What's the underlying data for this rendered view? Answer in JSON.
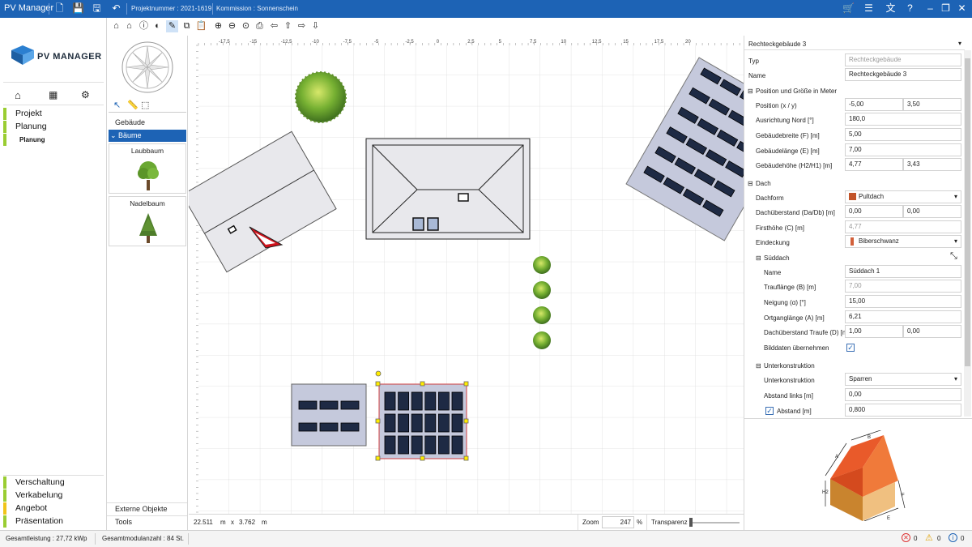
{
  "titlebar": {
    "app_name": "PV Manager",
    "project_number": "Projektnummer : 2021-1619",
    "commission": "Kommission : Sonnenschein"
  },
  "logo": {
    "text": "PV MANAGER"
  },
  "nav": {
    "sections_top": [
      {
        "label": "Projekt",
        "color": "#9acd32"
      },
      {
        "label": "Planung",
        "color": "#9acd32"
      }
    ],
    "sub_item": "Planung",
    "sections_bottom": [
      {
        "label": "Verschaltung",
        "color": "#9acd32"
      },
      {
        "label": "Verkabelung",
        "color": "#9acd32"
      },
      {
        "label": "Angebot",
        "color": "#f0c419"
      },
      {
        "label": "Präsentation",
        "color": "#9acd32"
      }
    ]
  },
  "catalog": {
    "group_buildings": "Gebäude",
    "group_trees": "Bäume",
    "card1": "Laubbaum",
    "card2": "Nadelbaum",
    "external": "Externe Objekte",
    "tools": "Tools"
  },
  "ruler": {
    "x_ticks": [
      "-17,5",
      "-15",
      "-12,5",
      "-10",
      "-7,5",
      "-5",
      "-2,5",
      "0",
      "2,5",
      "5",
      "7,5",
      "10",
      "12,5",
      "15",
      "17,5",
      "20"
    ]
  },
  "canvas_status": {
    "coord_x": "22.511",
    "unit1": "m",
    "times": "x",
    "coord_y": "3.762",
    "unit2": "m",
    "zoom_label": "Zoom",
    "zoom_value": "247",
    "zoom_unit": "%",
    "transparency_label": "Transparenz",
    "transparency": 0.0
  },
  "props": {
    "header": "Rechteckgebäude 3",
    "typ_label": "Typ",
    "typ_value": "Rechteckgebäude",
    "name_label": "Name",
    "name_value": "Rechteckgebäude 3",
    "sec_position": "Position und Größe in Meter",
    "pos_label": "Position (x / y)",
    "pos_x": "-5,00",
    "pos_y": "3,50",
    "north_label": "Ausrichtung Nord [°]",
    "north_value": "180,0",
    "width_label": "Gebäudebreite (F) [m]",
    "width_value": "5,00",
    "length_label": "Gebäudelänge (E) [m]",
    "length_value": "7,00",
    "height_label": "Gebäudehöhe (H2/H1) [m]",
    "height_h2": "4,77",
    "height_h1": "3,43",
    "sec_roof": "Dach",
    "roofform_label": "Dachform",
    "roofform_value": "Pultdach",
    "overhang_label": "Dachüberstand (Da/Db) [m]",
    "overhang_a": "0,00",
    "overhang_b": "0,00",
    "ridge_label": "Firsthöhe (C) [m]",
    "ridge_value": "4,77",
    "covering_label": "Eindeckung",
    "covering_value": "Biberschwanz",
    "sec_south": "Süddach",
    "s_name_label": "Name",
    "s_name_value": "Süddach 1",
    "eave_label": "Trauflänge (B) [m]",
    "eave_value": "7,00",
    "tilt_label": "Neigung (α) [°]",
    "tilt_value": "15,00",
    "gable_label": "Ortganglänge (A) [m]",
    "gable_value": "6,21",
    "eaveover_label": "Dachüberstand Traufe (D) [m]",
    "eaveover_a": "1,00",
    "eaveover_b": "0,00",
    "imgdata_label": "Bilddaten übernehmen",
    "sec_sub": "Unterkonstruktion",
    "sub_label": "Unterkonstruktion",
    "sub_value": "Sparren",
    "left_label": "Abstand links [m]",
    "left_value": "0,00",
    "dist_label": "Abstand [m]",
    "dist_value": "0,800"
  },
  "status": {
    "total_power": "Gesamtleistung : 27,72 kWp",
    "total_modules": "Gesamtmodulanzahl : 84 St.",
    "errors": "0",
    "warnings": "0",
    "infos": "0"
  },
  "colors": {
    "accent": "#1d63b5",
    "roof_red": "#e05a2a",
    "tree_green": "#6aa832"
  }
}
